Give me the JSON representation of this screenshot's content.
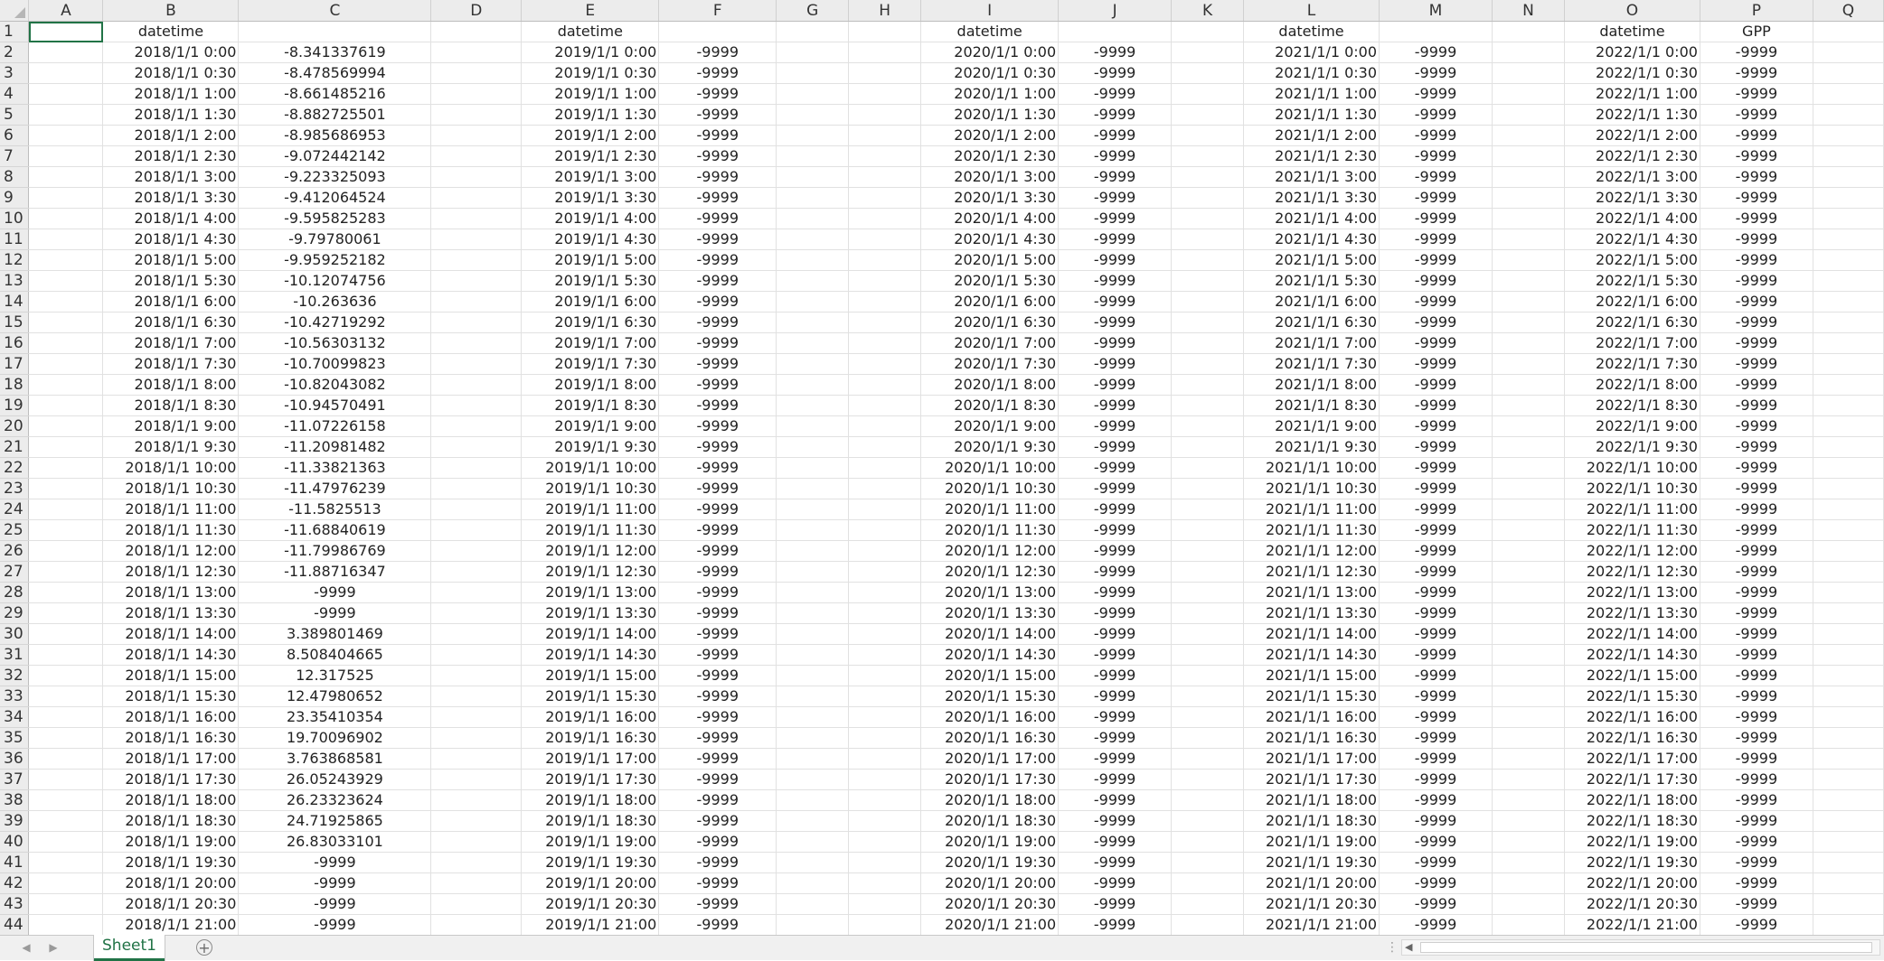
{
  "columns": [
    "A",
    "B",
    "C",
    "D",
    "E",
    "F",
    "G",
    "H",
    "I",
    "J",
    "K",
    "L",
    "M",
    "N",
    "O",
    "P",
    "Q"
  ],
  "headers": {
    "B": "datetime",
    "E": "datetime",
    "I": "datetime",
    "L": "datetime",
    "O": "datetime",
    "P": "GPP"
  },
  "years": [
    "2018",
    "2019",
    "2020",
    "2021",
    "2022"
  ],
  "times": [
    "0:00",
    "0:30",
    "1:00",
    "1:30",
    "2:00",
    "2:30",
    "3:00",
    "3:30",
    "4:00",
    "4:30",
    "5:00",
    "5:30",
    "6:00",
    "6:30",
    "7:00",
    "7:30",
    "8:00",
    "8:30",
    "9:00",
    "9:30",
    "10:00",
    "10:30",
    "11:00",
    "11:30",
    "12:00",
    "12:30",
    "13:00",
    "13:30",
    "14:00",
    "14:30",
    "15:00",
    "15:30",
    "16:00",
    "16:30",
    "17:00",
    "17:30",
    "18:00",
    "18:30",
    "19:00",
    "19:30",
    "20:00",
    "20:30",
    "21:00"
  ],
  "c_values": [
    "-8.341337619",
    "-8.478569994",
    "-8.661485216",
    "-8.882725501",
    "-8.985686953",
    "-9.072442142",
    "-9.223325093",
    "-9.412064524",
    "-9.595825283",
    "-9.79780061",
    "-9.959252182",
    "-10.12074756",
    "-10.263636",
    "-10.42719292",
    "-10.56303132",
    "-10.70099823",
    "-10.82043082",
    "-10.94570491",
    "-11.07226158",
    "-11.20981482",
    "-11.33821363",
    "-11.47976239",
    "-11.5825513",
    "-11.68840619",
    "-11.79986769",
    "-11.88716347",
    "-9999",
    "-9999",
    "3.389801469",
    "8.508404665",
    "12.317525",
    "12.47980652",
    "23.35410354",
    "19.70096902",
    "3.763868581",
    "26.05243929",
    "26.23323624",
    "24.71925865",
    "26.83033101",
    "-9999",
    "-9999",
    "-9999",
    "-9999"
  ],
  "fill_value": "-9999",
  "sheet_tab": "Sheet1",
  "add_sheet_symbol": "+"
}
